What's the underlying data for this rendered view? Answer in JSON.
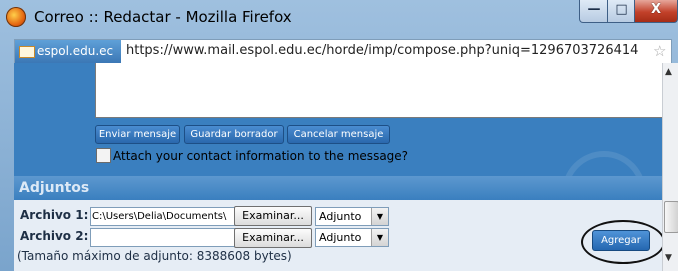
{
  "window": {
    "title": "Correo :: Redactar - Mozilla Firefox",
    "controls": {
      "minimize": "—",
      "maximize": "□",
      "close": "X"
    }
  },
  "addressbar": {
    "site_label": "espol.edu.ec",
    "url": "https://www.mail.espol.edu.ec/horde/imp/compose.php?uniq=1296703726414"
  },
  "compose": {
    "buttons": {
      "send": "Enviar mensaje",
      "save_draft": "Guardar borrador",
      "cancel": "Cancelar mensaje"
    },
    "attach_contact_label": "Attach your contact information to the message?"
  },
  "attachments": {
    "title": "Adjuntos",
    "rows": [
      {
        "label": "Archivo 1:",
        "value": "C:\\Users\\Delia\\Documents\\",
        "browse": "Examinar...",
        "disposition": "Adjunto"
      },
      {
        "label": "Archivo 2:",
        "value": "",
        "browse": "Examinar...",
        "disposition": "Adjunto"
      }
    ],
    "add_button": "Agregar",
    "size_note": "(Tamaño máximo de adjunto: 8388608 bytes)"
  },
  "icons": {
    "browser": "firefox-icon",
    "site": "mail-icon",
    "bookmark": "star-icon"
  }
}
